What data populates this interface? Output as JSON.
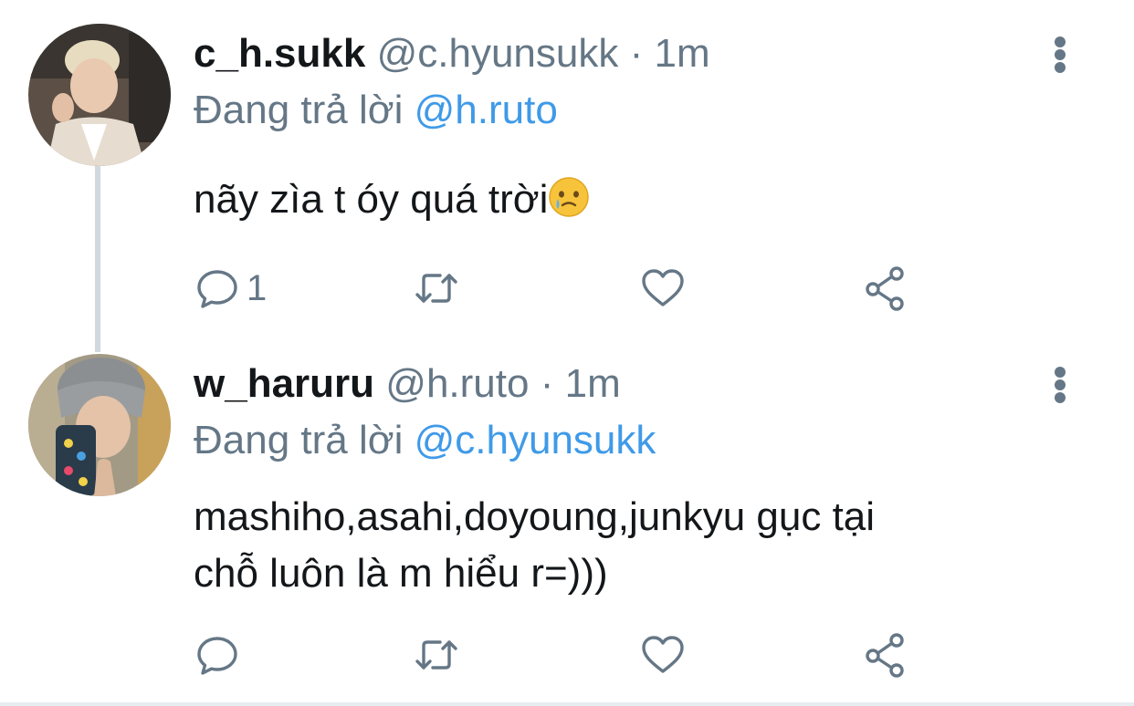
{
  "tweets": [
    {
      "display_name": "c_h.sukk",
      "handle": "@c.hyunsukk",
      "separator": "·",
      "time": "1m",
      "reply_prefix": "Đang trả lời",
      "reply_to": "@h.ruto",
      "text": "nãy zìa t óy quá trời",
      "text_emoji": "face-holding-back-tears-emoji",
      "reply_count": "1",
      "icons": {
        "avatar": "avatar-photo",
        "more": "more-vertical-icon",
        "reply": "comment-icon",
        "retweet": "retweet-icon",
        "like": "heart-icon",
        "share": "share-icon"
      }
    },
    {
      "display_name": "w_haruru",
      "handle": "@h.ruto",
      "separator": "·",
      "time": "1m",
      "reply_prefix": "Đang trả lời",
      "reply_to": "@c.hyunsukk",
      "text_line1": "mashiho,asahi,doyoung,junkyu gục tại",
      "text_line2": "chỗ luôn là m hiểu r=)))",
      "reply_count": "",
      "icons": {
        "avatar": "avatar-photo",
        "more": "more-vertical-icon",
        "reply": "comment-icon",
        "retweet": "retweet-icon",
        "like": "heart-icon",
        "share": "share-icon"
      }
    }
  ],
  "colors": {
    "text": "#14171a",
    "secondary": "#657786",
    "mention": "#3f9ae8",
    "thread_line": "#cfd9de"
  }
}
